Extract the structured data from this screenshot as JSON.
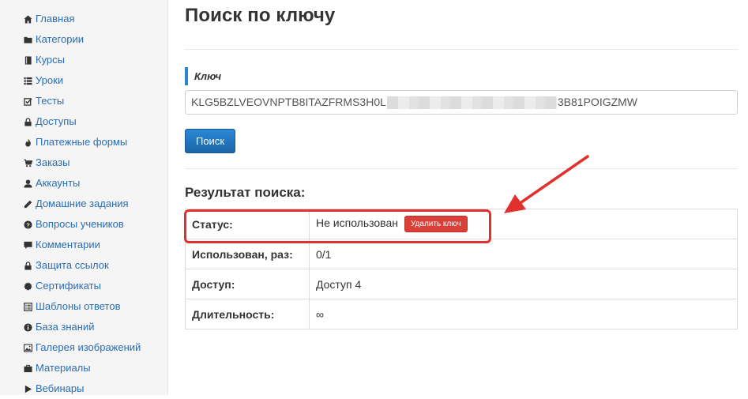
{
  "sidebar": {
    "items": [
      {
        "label": "Главная",
        "icon": "home-icon"
      },
      {
        "label": "Категории",
        "icon": "folder-icon"
      },
      {
        "label": "Курсы",
        "icon": "book-icon"
      },
      {
        "label": "Уроки",
        "icon": "list-icon"
      },
      {
        "label": "Тесты",
        "icon": "edit-check-icon"
      },
      {
        "label": "Доступы",
        "icon": "lock-icon"
      },
      {
        "label": "Платежные формы",
        "icon": "fire-icon"
      },
      {
        "label": "Заказы",
        "icon": "cart-icon"
      },
      {
        "label": "Аккаунты",
        "icon": "user-icon"
      },
      {
        "label": "Домашние задания",
        "icon": "pencil-icon"
      },
      {
        "label": "Вопросы учеников",
        "icon": "question-icon"
      },
      {
        "label": "Комментарии",
        "icon": "comment-icon"
      },
      {
        "label": "Защита ссылок",
        "icon": "lock-icon"
      },
      {
        "label": "Сертификаты",
        "icon": "certificate-icon"
      },
      {
        "label": "Шаблоны ответов",
        "icon": "list-alt-icon"
      },
      {
        "label": "База знаний",
        "icon": "info-icon"
      },
      {
        "label": "Галерея изображений",
        "icon": "picture-icon"
      },
      {
        "label": "Материалы",
        "icon": "briefcase-icon"
      },
      {
        "label": "Вебинары",
        "icon": "play-icon"
      }
    ]
  },
  "page": {
    "title": "Поиск по ключу",
    "field_label": "Ключ",
    "key_prefix": "KLG5BZLVEOVNPTB8ITAZFRMS3H0L",
    "key_suffix": "3B81POIGZMW",
    "search_label": "Поиск",
    "result_title": "Результат поиска:"
  },
  "result": {
    "rows": [
      {
        "key": "Статус:",
        "value": "Не использован",
        "action": "Удалить ключ"
      },
      {
        "key": "Использован, раз:",
        "value": "0/1"
      },
      {
        "key": "Доступ:",
        "value": "Доступ 4"
      },
      {
        "key": "Длительность:",
        "value": "∞"
      }
    ]
  },
  "colors": {
    "link": "#2a6db3",
    "primary": "#1f6fbf",
    "danger": "#d9403a",
    "annotation": "#e0312f"
  }
}
